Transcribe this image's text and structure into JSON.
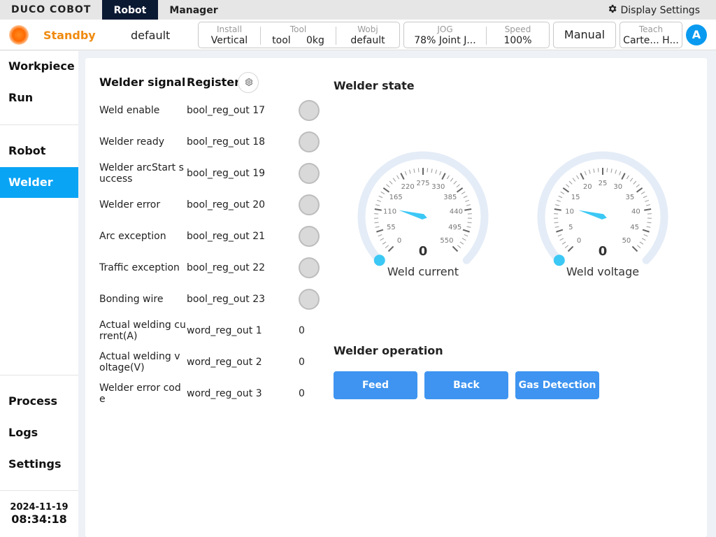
{
  "app": {
    "logo": "DUCO COBOT",
    "tabs": [
      {
        "label": "Robot",
        "active": true
      },
      {
        "label": "Manager",
        "active": false
      }
    ],
    "display_settings": "Display Settings"
  },
  "status": {
    "state": "Standby",
    "state_color": "#f08a10",
    "project": "default",
    "install": {
      "label": "Install",
      "value": "Vertical"
    },
    "tool": {
      "label": "Tool",
      "name": "tool",
      "weight": "0kg"
    },
    "wobj": {
      "label": "Wobj",
      "value": "default"
    },
    "jog": {
      "label": "JOG",
      "value": "78%  Joint J..."
    },
    "speed": {
      "label": "Speed",
      "value": "100%"
    },
    "mode": "Manual",
    "teach": {
      "label": "Teach",
      "value": "Carte... H..."
    },
    "avatar": "A"
  },
  "sidebar": {
    "items": [
      {
        "label": "Workpiece",
        "active": false
      },
      {
        "label": "Run",
        "active": false
      },
      {
        "label": "Robot",
        "active": false
      },
      {
        "label": "Welder",
        "active": true
      },
      {
        "label": "Process",
        "active": false
      },
      {
        "label": "Logs",
        "active": false
      },
      {
        "label": "Settings",
        "active": false
      }
    ],
    "date": "2024-11-19",
    "time": "08:34:18"
  },
  "signals": {
    "header_signal": "Welder signal",
    "header_register": "Register",
    "rows": [
      {
        "name": "Weld enable",
        "register": "bool_reg_out 17",
        "kind": "led",
        "on": false
      },
      {
        "name": "Welder ready",
        "register": "bool_reg_out 18",
        "kind": "led",
        "on": false
      },
      {
        "name": "Welder arcStart success",
        "register": "bool_reg_out 19",
        "kind": "led",
        "on": false
      },
      {
        "name": "Welder error",
        "register": "bool_reg_out 20",
        "kind": "led",
        "on": false
      },
      {
        "name": "Arc exception",
        "register": "bool_reg_out 21",
        "kind": "led",
        "on": false
      },
      {
        "name": "Traffic exception",
        "register": "bool_reg_out 22",
        "kind": "led",
        "on": false
      },
      {
        "name": "Bonding wire",
        "register": "bool_reg_out 23",
        "kind": "led",
        "on": false
      },
      {
        "name": "Actual welding current(A)",
        "register": "word_reg_out 1",
        "kind": "value",
        "value": "0"
      },
      {
        "name": "Actual welding voltage(V)",
        "register": "word_reg_out 2",
        "kind": "value",
        "value": "0"
      },
      {
        "name": "Welder error code",
        "register": "word_reg_out 3",
        "kind": "value",
        "value": "0"
      }
    ]
  },
  "welder_state": {
    "title": "Welder state",
    "gauges": [
      {
        "label": "Weld current",
        "value": "0",
        "ticks": [
          "0",
          "55",
          "110",
          "165",
          "220",
          "275",
          "330",
          "385",
          "440",
          "495",
          "550"
        ],
        "max": 550
      },
      {
        "label": "Weld voltage",
        "value": "0",
        "ticks": [
          "0",
          "5",
          "10",
          "15",
          "20",
          "25",
          "30",
          "35",
          "40",
          "45",
          "50"
        ],
        "max": 50
      }
    ],
    "accent_color": "#3cc8f5"
  },
  "operation": {
    "title": "Welder operation",
    "buttons": [
      "Feed",
      "Back",
      "Gas Detection"
    ],
    "button_color": "#3e94f0"
  }
}
